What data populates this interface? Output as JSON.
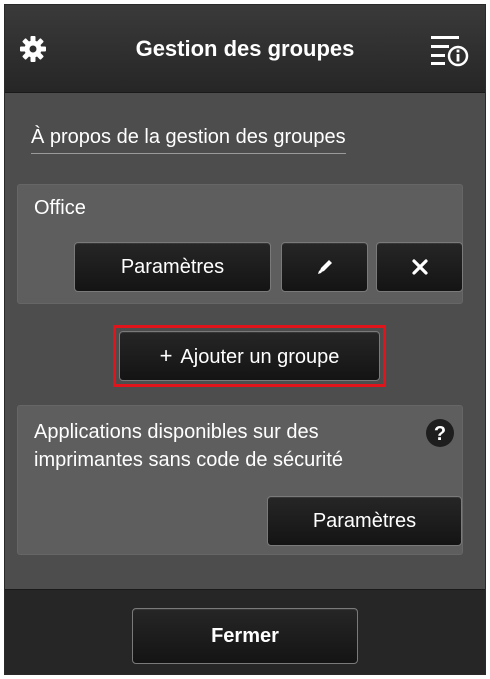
{
  "header": {
    "title": "Gestion des groupes",
    "left_icon": "gear-icon",
    "right_icon": "menu-info-icon"
  },
  "about_link": "À propos de la gestion des groupes",
  "group": {
    "name": "Office",
    "settings_label": "Paramètres",
    "edit_icon": "pencil-icon",
    "delete_icon": "close-icon"
  },
  "add_group": {
    "plus": "+",
    "label": "Ajouter un groupe"
  },
  "apps": {
    "text": "Applications disponibles sur des imprimantes sans code de sécurité",
    "help_icon": "help-icon",
    "settings_label": "Paramètres"
  },
  "footer": {
    "close_label": "Fermer"
  },
  "colors": {
    "background": "#4d4d4d",
    "panel": "#5e5e5e",
    "header": "#262626",
    "button": "#1a1a1a",
    "highlight": "#e0141a",
    "text": "#ffffff"
  }
}
